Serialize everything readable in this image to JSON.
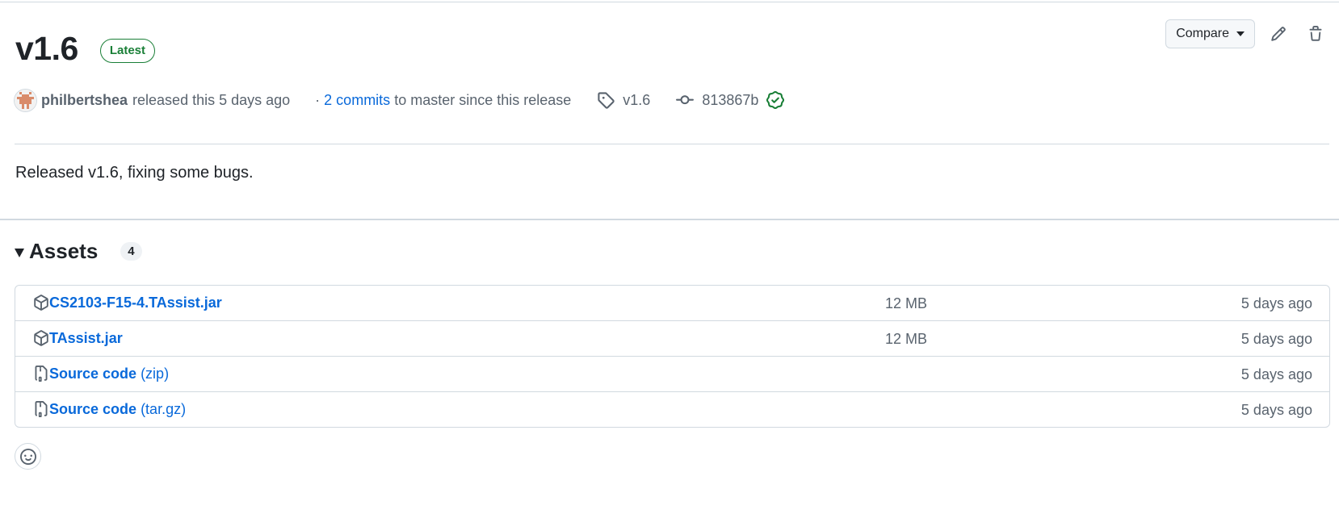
{
  "release": {
    "title": "v1.6",
    "badge": "Latest",
    "author": "philbertshea",
    "released_text": "released this 5 days ago",
    "dot": "·",
    "commits_link": "2 commits",
    "commits_suffix": "to master since this release",
    "tag": "v1.6",
    "commit_sha": "813867b",
    "body": "Released v1.6, fixing some bugs."
  },
  "actions": {
    "compare_label": "Compare"
  },
  "assets": {
    "title": "Assets",
    "count": "4",
    "items": [
      {
        "name": "CS2103-F15-4.TAssist.jar",
        "suffix": "",
        "size": "12 MB",
        "date": "5 days ago",
        "icon": "package-icon"
      },
      {
        "name": "TAssist.jar",
        "suffix": "",
        "size": "12 MB",
        "date": "5 days ago",
        "icon": "package-icon"
      },
      {
        "name": "Source code",
        "suffix": "(zip)",
        "size": "",
        "date": "5 days ago",
        "icon": "file-zip-icon"
      },
      {
        "name": "Source code",
        "suffix": "(tar.gz)",
        "size": "",
        "date": "5 days ago",
        "icon": "file-zip-icon"
      }
    ]
  },
  "colors": {
    "link": "#0969da",
    "success": "#1a7f37",
    "muted": "#59636e",
    "border": "#d1d9e0"
  }
}
